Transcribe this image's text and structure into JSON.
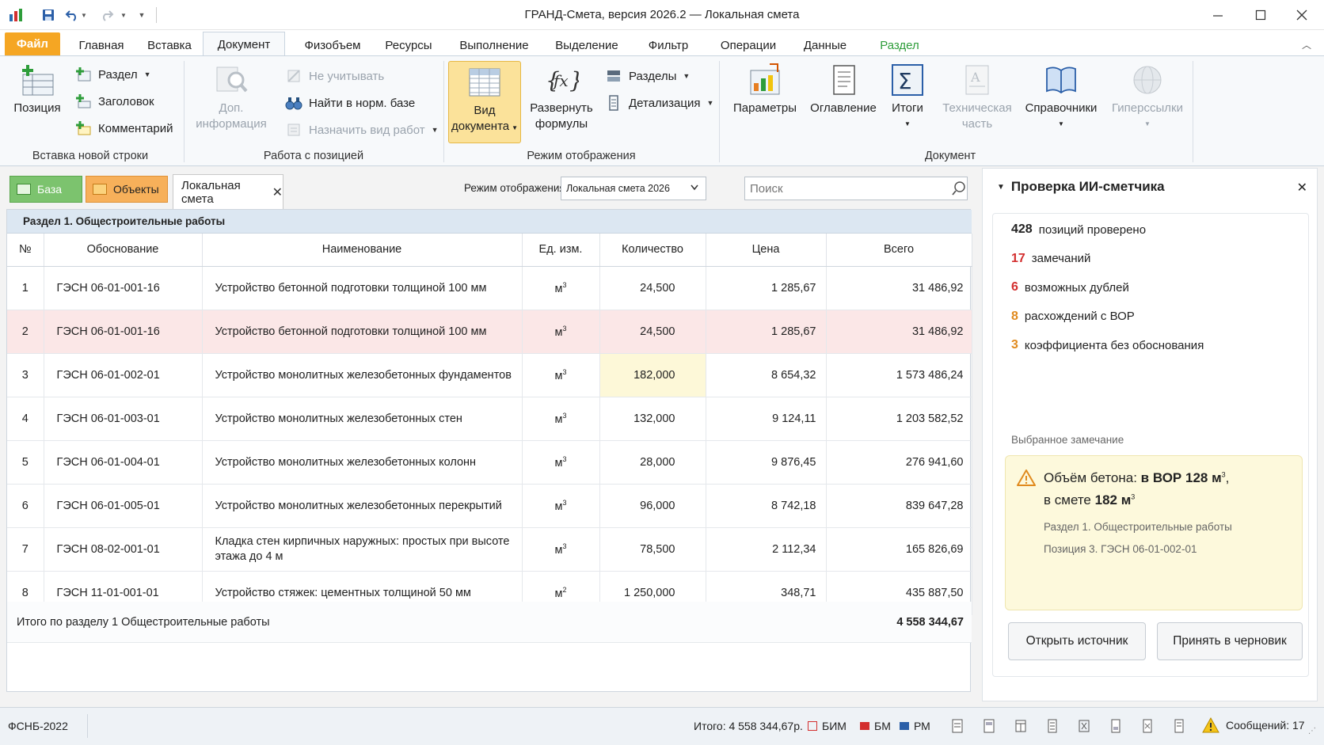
{
  "window": {
    "title": "ГРАНД-Смета, версия 2026.2 — Локальная смета"
  },
  "ribbon_tabs": [
    "Файл",
    "Главная",
    "Вставка",
    "Документ",
    "Физобъем",
    "Ресурсы",
    "Выполнение",
    "Выделение",
    "Фильтр",
    "Операции",
    "Данные",
    "Раздел"
  ],
  "ribbon": {
    "insert_group": {
      "label": "Вставка новой строки",
      "position": "Позиция",
      "section": "Раздел",
      "heading": "Заголовок",
      "comment": "Комментарий"
    },
    "position_group": {
      "label": "Работа с позицией",
      "extra_info_1": "Доп.",
      "extra_info_2": "информация",
      "ignore": "Не учитывать",
      "find": "Найти в норм. базе",
      "assign": "Назначить вид работ"
    },
    "view_group": {
      "label": "Режим отображения",
      "doc_view_1": "Вид",
      "doc_view_2": "документа",
      "expand_1": "Развернуть",
      "expand_2": "формулы",
      "sections": "Разделы",
      "detail": "Детализация"
    },
    "document_group": {
      "label": "Документ",
      "params": "Параметры",
      "toc": "Оглавление",
      "totals": "Итоги",
      "tech_1": "Техническая",
      "tech_2": "часть",
      "refs": "Справочники",
      "links": "Гиперссылки"
    }
  },
  "doc_tabs": {
    "base": "База",
    "objects": "Объекты",
    "estimate": "Локальная смета"
  },
  "view_mode": {
    "label": "Режим отображения",
    "value": "Локальная смета 2026"
  },
  "search": {
    "placeholder": "Поиск"
  },
  "grid": {
    "section_title": "Раздел 1. Общестроительные работы",
    "headers": [
      "№",
      "Обоснование",
      "Наименование",
      "Ед. изм.",
      "Количество",
      "Цена",
      "Всего"
    ],
    "rows": [
      {
        "n": "1",
        "code": "ГЭСН 06-01-001-16",
        "name": "Устройство бетонной подготовки толщиной 100 мм",
        "unit": "м",
        "exp": "3",
        "qty": "24,500",
        "price": "1 285,67",
        "total": "31 486,92"
      },
      {
        "n": "2",
        "code": "ГЭСН 06-01-001-16",
        "name": "Устройство бетонной подготовки толщиной 100 мм",
        "unit": "м",
        "exp": "3",
        "qty": "24,500",
        "price": "1 285,67",
        "total": "31 486,92"
      },
      {
        "n": "3",
        "code": "ГЭСН 06-01-002-01",
        "name": "Устройство монолитных железобетонных фундаментов",
        "unit": "м",
        "exp": "3",
        "qty": "182,000",
        "price": "8 654,32",
        "total": "1 573 486,24"
      },
      {
        "n": "4",
        "code": "ГЭСН 06-01-003-01",
        "name": "Устройство монолитных железобетонных стен",
        "unit": "м",
        "exp": "3",
        "qty": "132,000",
        "price": "9 124,11",
        "total": "1 203 582,52"
      },
      {
        "n": "5",
        "code": "ГЭСН 06-01-004-01",
        "name": "Устройство монолитных железобетонных колонн",
        "unit": "м",
        "exp": "3",
        "qty": "28,000",
        "price": "9 876,45",
        "total": "276 941,60"
      },
      {
        "n": "6",
        "code": "ГЭСН 06-01-005-01",
        "name": "Устройство монолитных железобетонных перекрытий",
        "unit": "м",
        "exp": "3",
        "qty": "96,000",
        "price": "8 742,18",
        "total": "839 647,28"
      },
      {
        "n": "7",
        "code": "ГЭСН 08-02-001-01",
        "name": "Кладка стен кирпичных наружных: простых при высоте этажа до 4 м",
        "unit": "м",
        "exp": "3",
        "qty": "78,500",
        "price": "2 112,34",
        "total": "165 826,69"
      },
      {
        "n": "8",
        "code": "ГЭСН 11-01-001-01",
        "name": "Устройство стяжек: цементных толщиной 50 мм",
        "unit": "м",
        "exp": "2",
        "qty": "1 250,000",
        "price": "348,71",
        "total": "435 887,50"
      }
    ],
    "total_label": "Итого по разделу 1 Общестроительные работы",
    "total_value": "4 558 344,67"
  },
  "ai_panel": {
    "title": "Проверка ИИ-сметчика",
    "stats": [
      {
        "n": "428",
        "text": "позиций проверено",
        "color": "#222222"
      },
      {
        "n": "17",
        "text": "замечаний",
        "color": "#d32f2f"
      },
      {
        "n": "6",
        "text": "возможных дублей",
        "color": "#d32f2f"
      },
      {
        "n": "8",
        "text": "расхождений с ВОР",
        "color": "#e08a1e"
      },
      {
        "n": "3",
        "text": "коэффициента без обоснования",
        "color": "#e08a1e"
      }
    ],
    "selected_label": "Выбранное замечание",
    "issue": {
      "pre": "Объём бетона:",
      "bold1": "в ВОР 128 м",
      "exp1": "3",
      "comma": ",",
      "pre2": "в смете",
      "bold2": "182 м",
      "exp2": "3",
      "section": "Раздел 1. Общестроительные работы",
      "position": "Позиция 3. ГЭСН 06-01-002-01"
    },
    "open_source": "Открыть источник",
    "accept_draft": "Принять в черновик"
  },
  "statusbar": {
    "base": "ФСНБ-2022",
    "total": "Итого: 4 558 344,67р.",
    "bim": "БИМ",
    "bm": "БМ",
    "rm": "РМ",
    "messages": "Сообщений: 17"
  },
  "colors": {
    "file_tab": "#f5a623",
    "accent_green": "#2e9d3a",
    "warning": "#e08a1e",
    "error": "#d32f2f"
  }
}
